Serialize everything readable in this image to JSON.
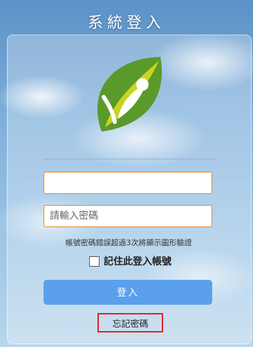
{
  "header": {
    "title": "系統登入"
  },
  "login_form": {
    "username": {
      "value": "",
      "placeholder": ""
    },
    "password": {
      "value": "",
      "placeholder": "請輸入密碼"
    },
    "hint_text": "帳號密碼錯誤超過3次將顯示圖形驗證",
    "remember_label": "記住此登入帳號",
    "remember_checked": false,
    "login_button": "登入",
    "forgot_password": "忘記密碼"
  },
  "colors": {
    "field_border": "#e0872a",
    "login_button": "#5aa0ec",
    "forgot_highlight": "#e02020",
    "logo_green": "#5a9a2a",
    "logo_yellow": "#c8d422"
  },
  "icons": {
    "logo": "green-leaf-person-logo"
  }
}
